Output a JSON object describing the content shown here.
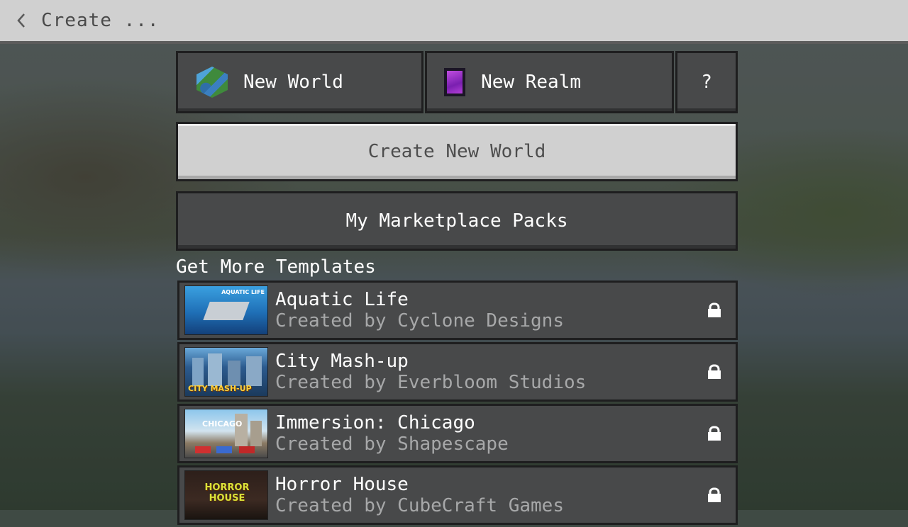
{
  "header": {
    "back_icon": "chevron-left-icon",
    "title": "Create ..."
  },
  "tabs": {
    "new_world": {
      "label": "New World",
      "icon": "globe-icon"
    },
    "new_realm": {
      "label": "New Realm",
      "icon": "portal-icon"
    },
    "help": {
      "label": "?"
    }
  },
  "actions": {
    "create_new_world": "Create New World",
    "marketplace_packs": "My Marketplace Packs"
  },
  "templates": {
    "section_title": "Get More Templates",
    "items": [
      {
        "title": "Aquatic Life",
        "subtitle": "Created by Cyclone Designs",
        "thumb_text": "AQUATIC LIFE",
        "icon": "lock-icon"
      },
      {
        "title": "City Mash-up",
        "subtitle": "Created by Everbloom Studios",
        "thumb_text": "CITY MASH-UP",
        "icon": "lock-icon"
      },
      {
        "title": "Immersion: Chicago",
        "subtitle": "Created by Shapescape",
        "thumb_text": "CHICAGO",
        "icon": "lock-icon"
      },
      {
        "title": "Horror House",
        "subtitle": "Created by CubeCraft Games",
        "thumb_text": "HORROR HOUSE",
        "icon": "lock-icon"
      }
    ]
  },
  "colors": {
    "panel": "#48494a",
    "panel_border": "#1e1e1f",
    "light_button": "#d0d0d0",
    "subtitle_text": "#a7a8a9"
  }
}
